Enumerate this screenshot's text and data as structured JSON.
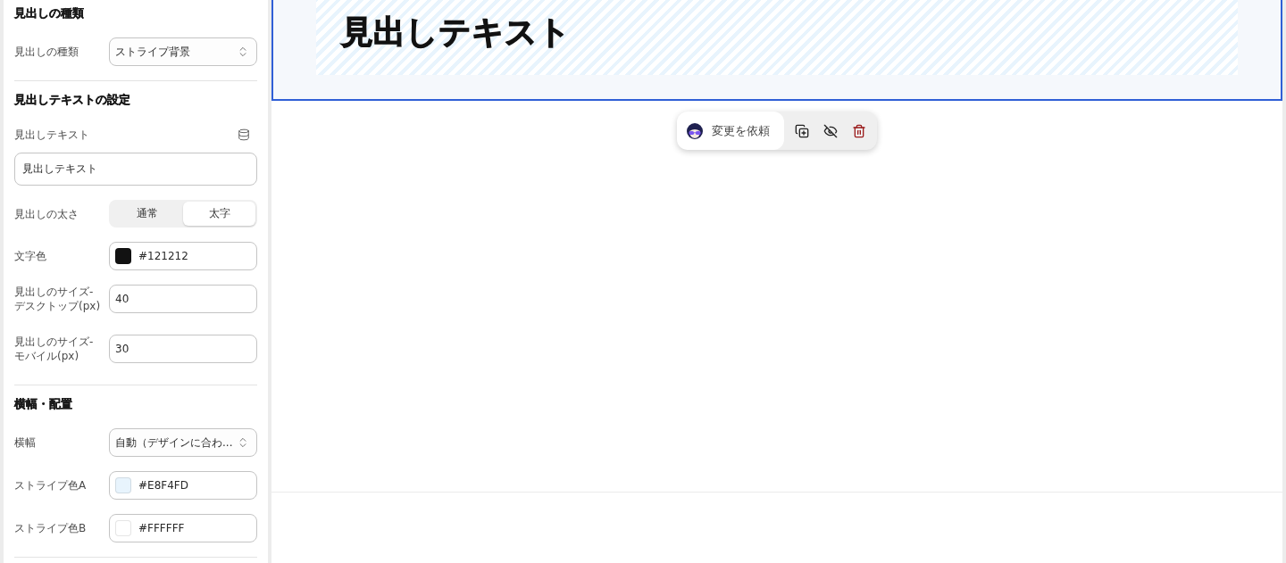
{
  "sidebar": {
    "sections": [
      {
        "title": "見出しの種類",
        "fields": [
          {
            "kind": "select",
            "label": "見出しの種類",
            "value": "ストライプ背景"
          }
        ]
      },
      {
        "title": "見出しテキストの設定",
        "fields": [
          {
            "kind": "text",
            "label": "見出しテキスト",
            "value": "見出しテキスト"
          },
          {
            "kind": "segmented",
            "label": "見出しの太さ",
            "options": [
              {
                "label": "通常",
                "selected": false
              },
              {
                "label": "太字",
                "selected": true
              }
            ]
          },
          {
            "kind": "color",
            "label": "文字色",
            "value": "#121212",
            "color": "#121212"
          },
          {
            "kind": "number",
            "label": "見出しのサイズ-デスクトップ(px)",
            "value": "40"
          },
          {
            "kind": "number",
            "label": "見出しのサイズ-モバイル(px)",
            "value": "30"
          }
        ]
      },
      {
        "title": "横幅・配置",
        "fields": [
          {
            "kind": "select",
            "label": "横幅",
            "value": "自動（デザインに合わ..."
          },
          {
            "kind": "color",
            "label": "ストライプ色A",
            "value": "#E8F4FD",
            "color": "#e8f4fd"
          },
          {
            "kind": "color",
            "label": "ストライプ色B",
            "value": "#FFFFFF",
            "color": "#ffffff"
          }
        ]
      }
    ]
  },
  "canvas": {
    "heading_block": {
      "text": "見出しテキスト",
      "selected": true
    },
    "toolbar": {
      "request_button": "変更を依頼"
    }
  }
}
